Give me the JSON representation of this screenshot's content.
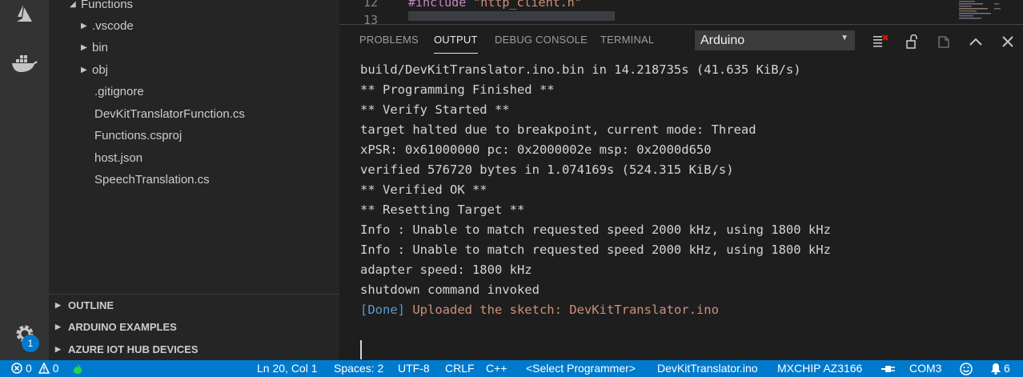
{
  "sidebar": {
    "folder_label": "Functions",
    "items": [
      {
        "label": ".vscode"
      },
      {
        "label": "bin"
      },
      {
        "label": "obj"
      },
      {
        "label": ".gitignore"
      },
      {
        "label": "DevKitTranslatorFunction.cs"
      },
      {
        "label": "Functions.csproj"
      },
      {
        "label": "host.json"
      },
      {
        "label": "SpeechTranslation.cs"
      }
    ],
    "sections": [
      {
        "label": "OUTLINE"
      },
      {
        "label": "ARDUINO EXAMPLES"
      },
      {
        "label": "AZURE IOT HUB DEVICES"
      }
    ]
  },
  "activity": {
    "icons": [
      "azure-icon",
      "docker-icon",
      "gear-icon"
    ],
    "settings_badge": "1"
  },
  "editor": {
    "line_12": "12",
    "line_13": "13",
    "code": "#include ",
    "code_string": "\"http_client.h\""
  },
  "panel": {
    "tabs": [
      "PROBLEMS",
      "OUTPUT",
      "DEBUG CONSOLE",
      "TERMINAL"
    ],
    "active_tab": "OUTPUT",
    "channel": "Arduino",
    "output_lines": [
      "build/DevKitTranslator.ino.bin in 14.218735s (41.635 KiB/s)",
      "** Programming Finished **",
      "** Verify Started **",
      "target halted due to breakpoint, current mode: Thread",
      "xPSR: 0x61000000 pc: 0x2000002e msp: 0x2000d650",
      "verified 576720 bytes in 1.074169s (524.315 KiB/s)",
      "** Verified OK **",
      "** Resetting Target **",
      "Info : Unable to match requested speed 2000 kHz, using 1800 kHz",
      "Info : Unable to match requested speed 2000 kHz, using 1800 kHz",
      "adapter speed: 1800 kHz",
      "shutdown command invoked"
    ],
    "done_tag": "[Done]",
    "done_message": " Uploaded the sketch: DevKitTranslator.ino"
  },
  "status": {
    "errors": "0",
    "warnings": "0",
    "position": "Ln 20, Col 1",
    "spaces": "Spaces: 2",
    "encoding": "UTF-8",
    "eol": "CRLF",
    "language": "C++",
    "programmer": "<Select Programmer>",
    "sketch": "DevKitTranslator.ino",
    "board": "MXCHIP AZ3166",
    "port": "COM3",
    "notifications": "6"
  },
  "colors": {
    "accent": "#007acc",
    "activity_bar": "#333333",
    "sidebar": "#252526",
    "editor_bg": "#1e1e1e",
    "done_tag": "#569cd6",
    "done_message": "#ce9178"
  }
}
